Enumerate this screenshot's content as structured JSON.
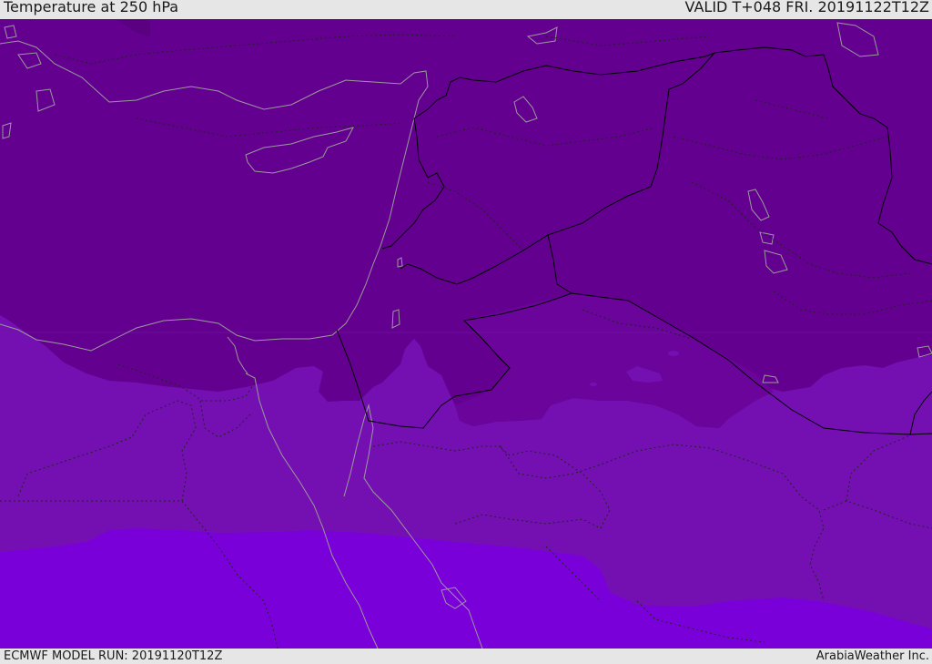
{
  "header": {
    "title": "Temperature at 250 hPa",
    "valid": "VALID T+048 FRI. 20191122T12Z"
  },
  "footer": {
    "model_run": "ECMWF MODEL RUN: 20191120T12Z",
    "brand": "ArabiaWeather Inc."
  },
  "map": {
    "colors": {
      "band_cold": "#63008f",
      "band_mid_dark": "#6a049a",
      "band_mid": "#7410b2",
      "band_warm": "#7a00d9",
      "country_border": "#000000",
      "coastline": "#9a9a9a",
      "admin_boundary": "#222222"
    }
  }
}
